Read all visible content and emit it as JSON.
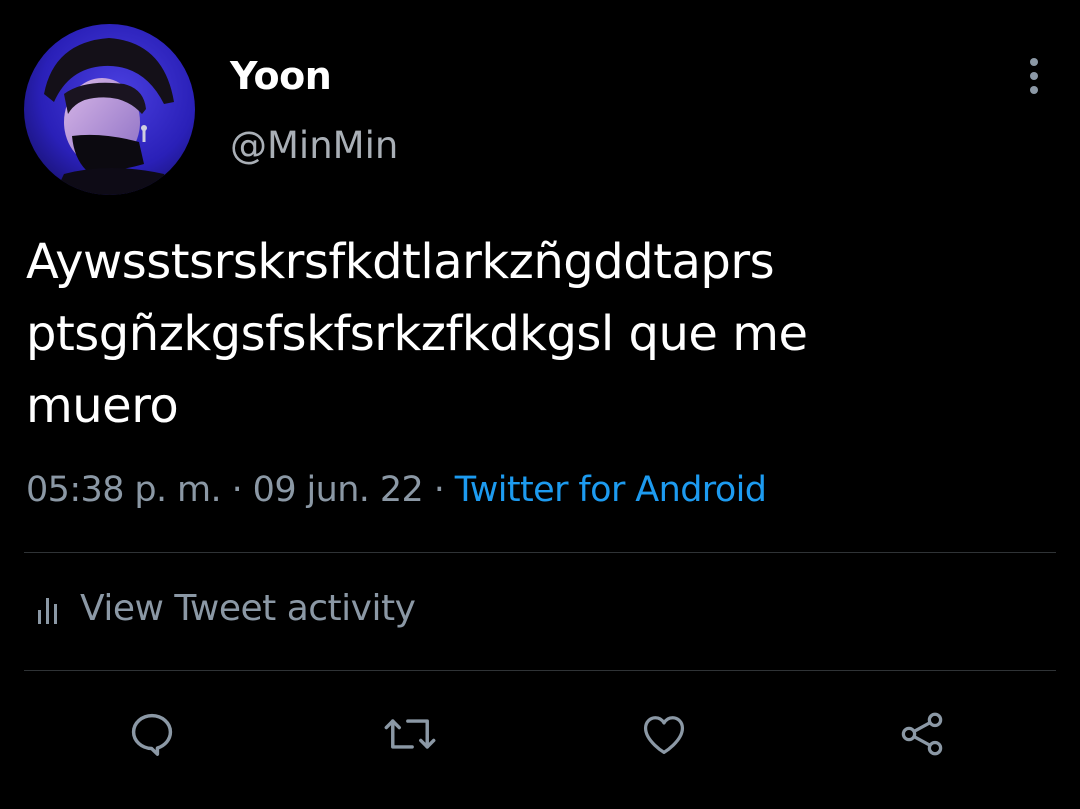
{
  "user": {
    "display_name": "Yoon",
    "handle": "@MinMin",
    "avatar_icon": "profile-photo"
  },
  "tweet": {
    "lines": [
      "Aywsstsrskrsfkdtlarkzñgddtaprs",
      "ptsgñzkgsfskfsrkzfkdkgsl que me",
      "muero"
    ]
  },
  "meta": {
    "time": "05:38 p. m.",
    "separator": " · ",
    "date": "09 jun. 22",
    "source": "Twitter for Android"
  },
  "activity": {
    "label": "View Tweet activity",
    "icon": "bar-chart-icon"
  },
  "actions": [
    {
      "name": "reply",
      "icon": "reply-icon"
    },
    {
      "name": "retweet",
      "icon": "retweet-icon"
    },
    {
      "name": "like",
      "icon": "heart-icon"
    },
    {
      "name": "share",
      "icon": "share-icon"
    }
  ],
  "colors": {
    "background": "#000000",
    "primary_text": "#ffffff",
    "secondary_text": "#8b98a5",
    "link": "#1d9bf0",
    "divider": "#2f3336",
    "icon": "#8b98a5"
  }
}
